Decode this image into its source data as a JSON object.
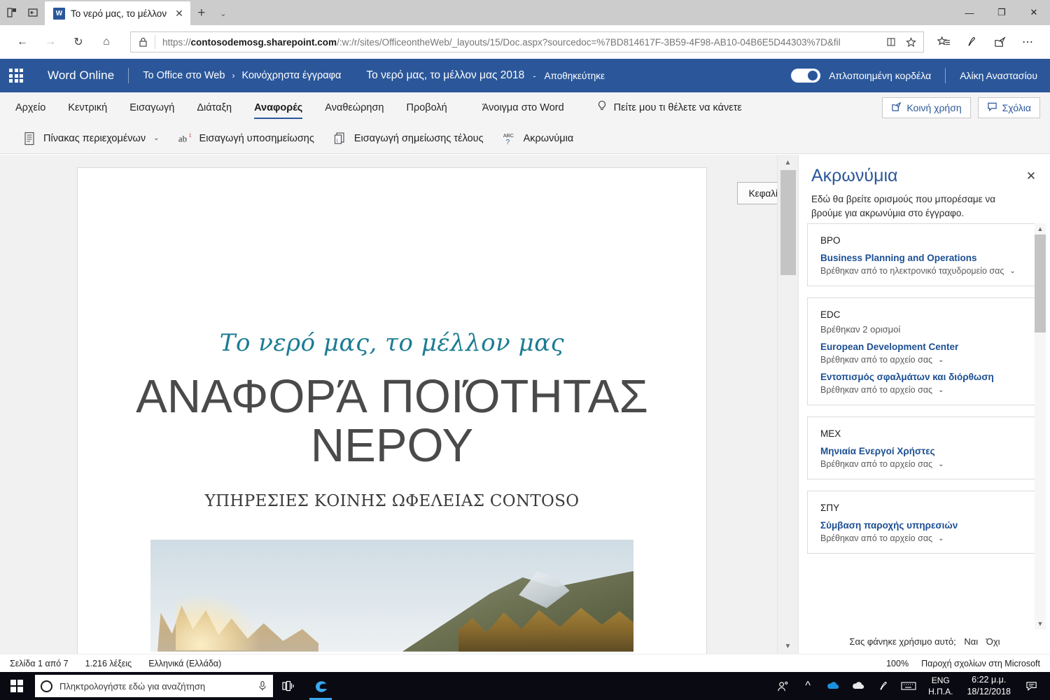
{
  "browser": {
    "tab": {
      "title": "Το νερό μας, το μέλλον",
      "app_icon": "word-icon",
      "close": "✕"
    },
    "new_tab": "+",
    "tab_list_chevron": "⌄",
    "window_controls": {
      "minimize": "—",
      "restore": "❐",
      "close": "✕"
    },
    "nav": {
      "back": "←",
      "forward": "→",
      "refresh": "↻",
      "home": "⌂"
    },
    "address": {
      "lock_icon": "lock-icon",
      "url_prefix": "https://",
      "url_domain": "contosodemosg.sharepoint.com",
      "url_path": "/:w:/r/sites/OfficeontheWeb/_layouts/15/Doc.aspx?sourcedoc=%7BD814617F-3B59-4F98-AB10-04B6E5D44303%7D&fil",
      "reading_view_icon": "reading-view-icon",
      "favorite_icon": "star-icon"
    },
    "toolbar_icons": {
      "favorites": "favorites-icon",
      "notes": "web-notes-icon",
      "share": "share-icon",
      "more": "⋯"
    }
  },
  "office_header": {
    "waffle": "app-launcher-icon",
    "app_name": "Word Online",
    "breadcrumb": {
      "site": "Το Office στο Web",
      "separator": "›",
      "library": "Κοινόχρηστα έγγραφα"
    },
    "document_title": "Το νερό μας, το μέλλον μας 2018",
    "dash": "-",
    "save_state": "Αποθηκεύτηκε",
    "simplified_ribbon_toggle": {
      "label": "Απλοποιημένη κορδέλα",
      "state": "on"
    },
    "user": "Αλίκη Αναστασίου"
  },
  "ribbon": {
    "tabs": [
      {
        "label": "Αρχείο",
        "active": false
      },
      {
        "label": "Κεντρική",
        "active": false
      },
      {
        "label": "Εισαγωγή",
        "active": false
      },
      {
        "label": "Διάταξη",
        "active": false
      },
      {
        "label": "Αναφορές",
        "active": true
      },
      {
        "label": "Αναθεώρηση",
        "active": false
      },
      {
        "label": "Προβολή",
        "active": false
      }
    ],
    "open_in_word": "Άνοιγμα στο Word",
    "tell_me": {
      "icon": "lightbulb-icon",
      "placeholder": "Πείτε μου τι θέλετε να κάνετε"
    },
    "share_button": {
      "label": "Κοινή χρήση",
      "icon": "share-icon"
    },
    "comments_button": {
      "label": "Σχόλια",
      "icon": "comment-icon"
    },
    "commands": [
      {
        "label": "Πίνακας περιεχομένων",
        "icon": "toc-icon",
        "has_chevron": true
      },
      {
        "label": "Εισαγωγή υποσημείωσης",
        "icon": "footnote-ab-icon",
        "has_chevron": false
      },
      {
        "label": "Εισαγωγή σημείωσης τέλους",
        "icon": "endnote-icon",
        "has_chevron": false
      },
      {
        "label": "Ακρωνύμια",
        "icon": "abc-question-icon",
        "has_chevron": false
      }
    ]
  },
  "document": {
    "header_tab_button": "Κεφαλίδα",
    "subtitle": "Το νερό μας, το μέλλον μας",
    "heading": "ΑΝΑΦΟΡΆ ΠΟΙΌΤΗΤΑΣ ΝΕΡΟΥ",
    "organization": "ΥΠΗΡΕΣΙΕΣ ΚΟΙΝΗΣ ΩΦΕΛΕΙΑΣ CONTOSO",
    "photo_alt": "mountain-landscape-photo",
    "accent_color": "#1b7c93",
    "heading_color": "#4a4a4a"
  },
  "acronyms_pane": {
    "title": "Ακρωνύμια",
    "close_icon": "✕",
    "description": "Εδώ θα βρείτε ορισμούς που μπορέσαμε να βρούμε για ακρωνύμια στο έγγραφο.",
    "cards": [
      {
        "abbr": "BPO",
        "count": "",
        "definitions": [
          {
            "term": "Business Planning and Operations",
            "source": "Βρέθηκαν από το ηλεκτρονικό ταχυδρομείο σας",
            "chevron": "⌄"
          }
        ]
      },
      {
        "abbr": "EDC",
        "count": "Βρέθηκαν 2 ορισμοί",
        "definitions": [
          {
            "term": "European Development Center",
            "source": "Βρέθηκαν από το αρχείο σας",
            "chevron": "⌄"
          },
          {
            "term": "Εντοπισμός σφαλμάτων και διόρθωση",
            "source": "Βρέθηκαν από το αρχείο σας",
            "chevron": "⌄"
          }
        ]
      },
      {
        "abbr": "MEX",
        "count": "",
        "definitions": [
          {
            "term": "Μηνιαία Ενεργοί Χρήστες",
            "source": "Βρέθηκαν από το αρχείο σας",
            "chevron": "⌄"
          }
        ]
      },
      {
        "abbr": "ΣΠΥ",
        "count": "",
        "definitions": [
          {
            "term": "Σύμβαση παροχής υπηρεσιών",
            "source": "Βρέθηκαν από το αρχείο σας",
            "chevron": "⌄"
          }
        ]
      }
    ],
    "feedback": {
      "question": "Σας φάνηκε χρήσιμο αυτό;",
      "yes": "Ναι",
      "no": "Όχι"
    },
    "link_color": "#1c4f93",
    "title_color": "#2b579a"
  },
  "status_bar": {
    "page": "Σελίδα 1 από 7",
    "words": "1.216 λέξεις",
    "language": "Ελληνικά (Ελλάδα)",
    "zoom": "100%",
    "feedback": "Παροχή σχολίων στη Microsoft"
  },
  "taskbar": {
    "start": "windows-logo-icon",
    "search_placeholder": "Πληκτρολογήστε εδώ για αναζήτηση",
    "mic_icon": "microphone-icon",
    "task_view_icon": "task-view-icon",
    "edge_icon": "edge-browser-icon",
    "tray": {
      "people_icon": "people-icon",
      "overflow_icon": "^",
      "onedrive_blue_icon": "onedrive-blue-icon",
      "onedrive_white_icon": "onedrive-white-icon",
      "pen_icon": "pen-icon",
      "keyboard_icon": "keyboard-icon",
      "language_line1": "ENG",
      "language_line2": "Η.Π.Α.",
      "time": "6:22 μ.μ.",
      "date": "18/12/2018",
      "action_center_icon": "action-center-icon"
    }
  },
  "colors": {
    "office_blue": "#2b579a",
    "taskbar": "#0a0a12",
    "accent_teal": "#1b7c93"
  }
}
